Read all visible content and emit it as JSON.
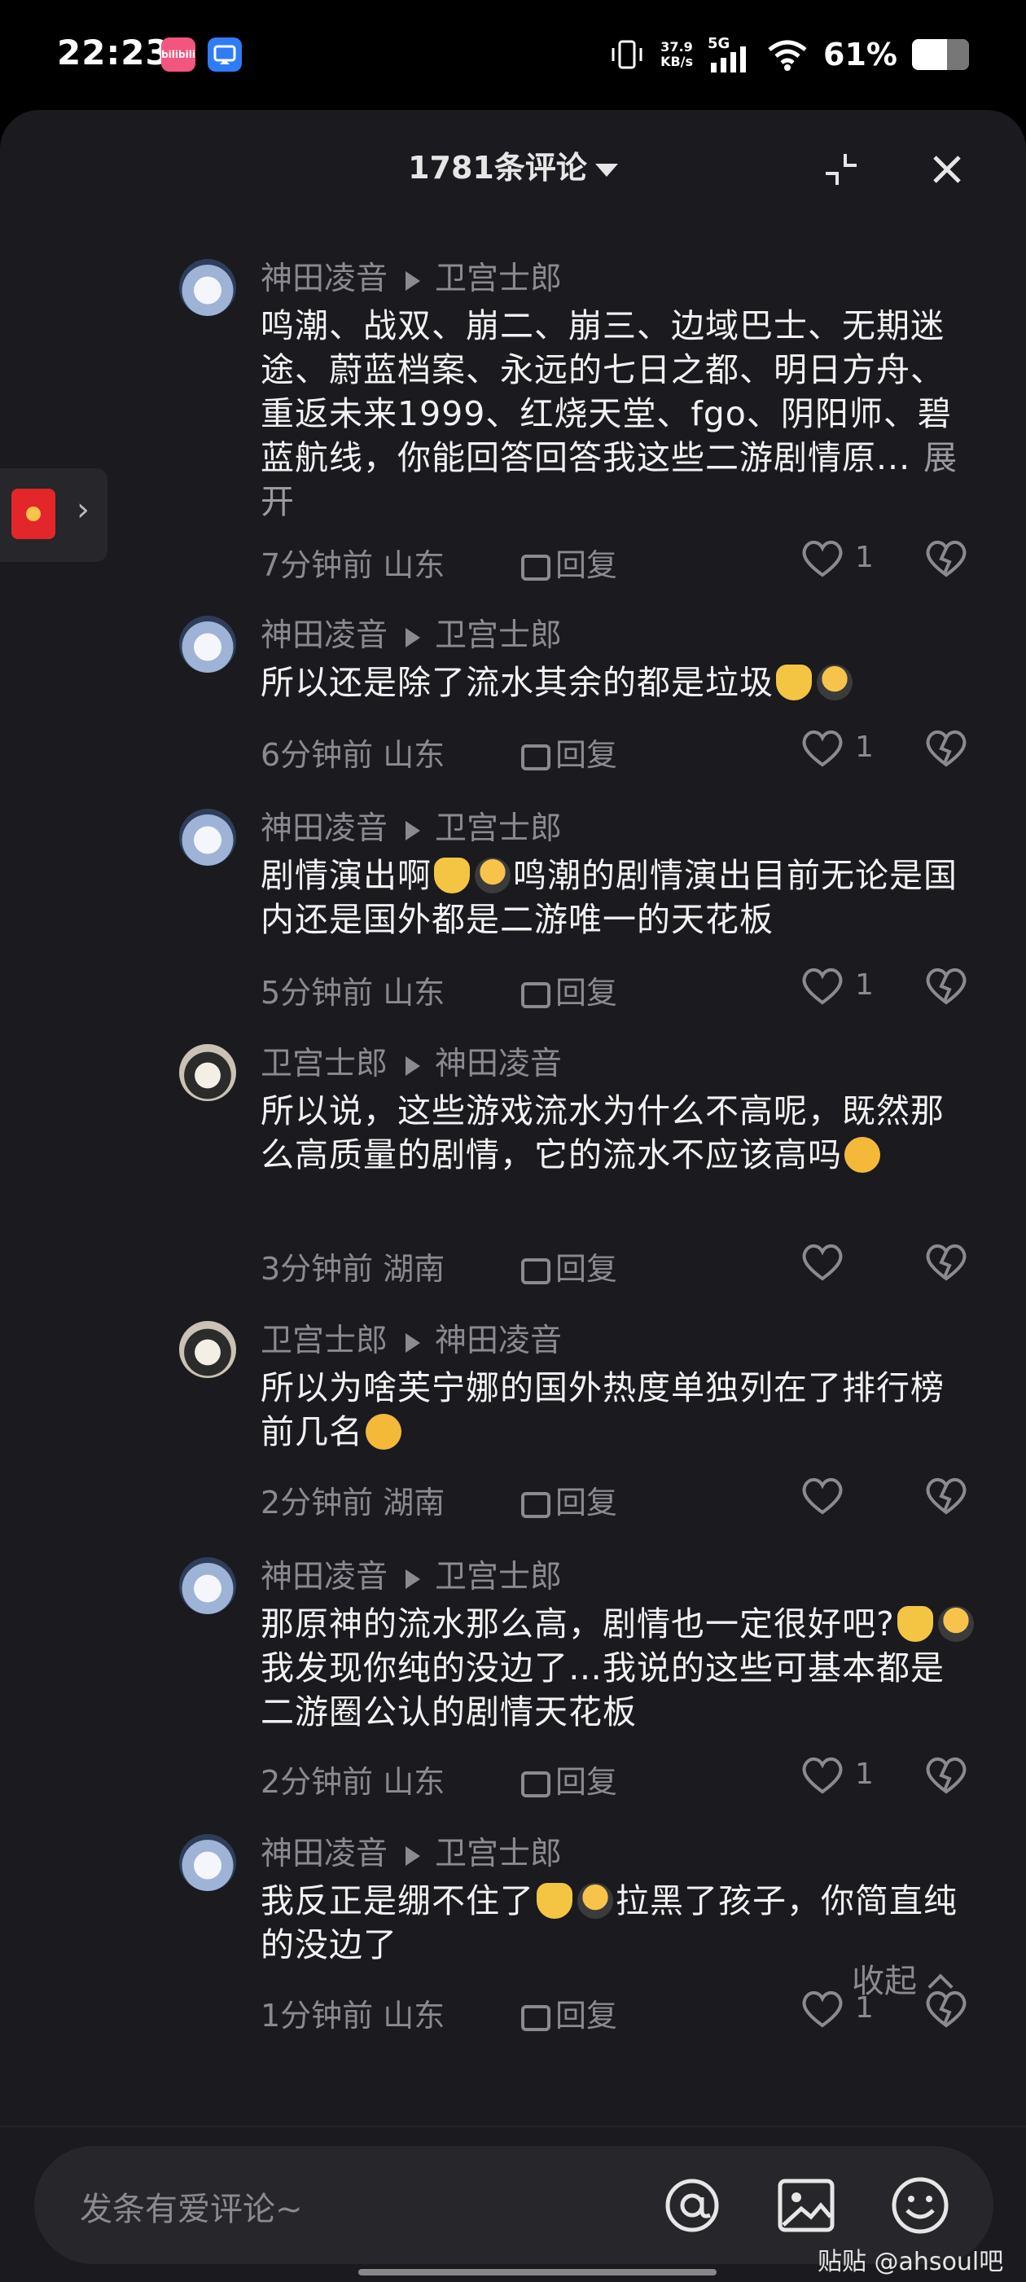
{
  "status": {
    "time": "22:23",
    "net_speed_top": "37.9",
    "net_speed_unit": "KB/s",
    "network_type": "5G",
    "battery_text": "61%",
    "battery_level": 0.61,
    "app1_label": "bilibili"
  },
  "header": {
    "title": "1781条评论"
  },
  "comments": [
    {
      "author": "神田凌音",
      "reply_to": "卫宫士郎",
      "text": "鸣潮、战双、崩二、崩三、边域巴士、无期迷途、蔚蓝档案、永远的七日之都、明日方舟、重返未来1999、红烧天堂、fgo、阴阳师、碧蓝航线，你能回答回答我这些二游剧情原...",
      "expand": "展开",
      "time": "7分钟前",
      "location": "山东",
      "reply": "回复",
      "likes": "1"
    },
    {
      "author": "神田凌音",
      "reply_to": "卫宫士郎",
      "text": "所以还是除了流水其余的都是垃圾",
      "time": "6分钟前",
      "location": "山东",
      "reply": "回复",
      "likes": "1"
    },
    {
      "author": "神田凌音",
      "reply_to": "卫宫士郎",
      "text_a": "剧情演出啊",
      "text_b": "鸣潮的剧情演出目前无论是国内还是国外都是二游唯一的天花板",
      "time": "5分钟前",
      "location": "山东",
      "reply": "回复",
      "likes": "1"
    },
    {
      "author": "卫宫士郎",
      "reply_to": "神田凌音",
      "text": "所以说，这些游戏流水为什么不高呢，既然那么高质量的剧情，它的流水不应该高吗",
      "time": "3分钟前",
      "location": "湖南",
      "reply": "回复",
      "likes": ""
    },
    {
      "author": "卫宫士郎",
      "reply_to": "神田凌音",
      "text": "所以为啥芙宁娜的国外热度单独列在了排行榜前几名",
      "time": "2分钟前",
      "location": "湖南",
      "reply": "回复",
      "likes": ""
    },
    {
      "author": "神田凌音",
      "reply_to": "卫宫士郎",
      "text_a": "那原神的流水那么高，剧情也一定很好吧?",
      "text_b": "我发现你纯的没边了…我说的这些可基本都是二游圈公认的剧情天花板",
      "time": "2分钟前",
      "location": "山东",
      "reply": "回复",
      "likes": "1"
    },
    {
      "author": "神田凌音",
      "reply_to": "卫宫士郎",
      "text_a": "我反正是绷不住了",
      "text_b": "拉黑了孩子，你简直纯的没边了",
      "time": "1分钟前",
      "location": "山东",
      "reply": "回复",
      "likes": "1"
    }
  ],
  "collapse_label": "收起",
  "input_placeholder": "发条有爱评论~",
  "watermark": "贴贴 @ahsoul吧",
  "icons": [
    "collapse-icon",
    "close-icon",
    "red-packet-icon",
    "heart-icon",
    "dislike-icon",
    "at-icon",
    "image-icon",
    "emoji-icon"
  ]
}
